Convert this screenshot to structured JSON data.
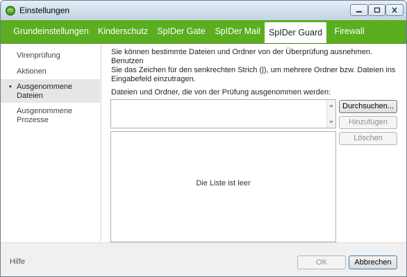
{
  "window": {
    "title": "Einstellungen"
  },
  "tabs": [
    {
      "label": "Grundeinstellungen",
      "active": false
    },
    {
      "label": "Kinderschutz",
      "active": false
    },
    {
      "label": "SpIDer Gate",
      "active": false
    },
    {
      "label": "SpIDer Mail",
      "active": false
    },
    {
      "label": "SpIDer Guard",
      "active": true
    },
    {
      "label": "Firewall",
      "active": false
    }
  ],
  "sidebar": {
    "items": [
      {
        "label_lines": [
          "Virenprüfung"
        ],
        "active": false
      },
      {
        "label_lines": [
          "Aktionen"
        ],
        "active": false
      },
      {
        "label_lines": [
          "Ausgenommene",
          "Dateien"
        ],
        "active": true,
        "bullet": "•"
      },
      {
        "label_lines": [
          "Ausgenommene",
          "Prozesse"
        ],
        "active": false
      }
    ]
  },
  "content": {
    "intro_lines": [
      "Sie können bestimmte Dateien und Ordner von der Überprüfung ausnehmen. Benutzen",
      "Sie das Zeichen für den senkrechten Strich (|), um mehrere Ordner bzw. Dateien ins",
      "Eingabefeld einzutragen."
    ],
    "section_label": "Dateien und Ordner, die von der Prüfung ausgenommen werden:",
    "path_input_value": "",
    "empty_list_text": "Die Liste ist leer",
    "browse_label": "Durchsuchen...",
    "add_label": "Hinzufügen",
    "delete_label": "Löschen"
  },
  "footer": {
    "help_label": "Hilfe",
    "ok_label": "OK",
    "cancel_label": "Abbrechen"
  },
  "colors": {
    "tab_bar": "#5aae1f",
    "active_sidebar_bg": "#e6e6e6",
    "footer_bg": "#f0f0f0"
  }
}
